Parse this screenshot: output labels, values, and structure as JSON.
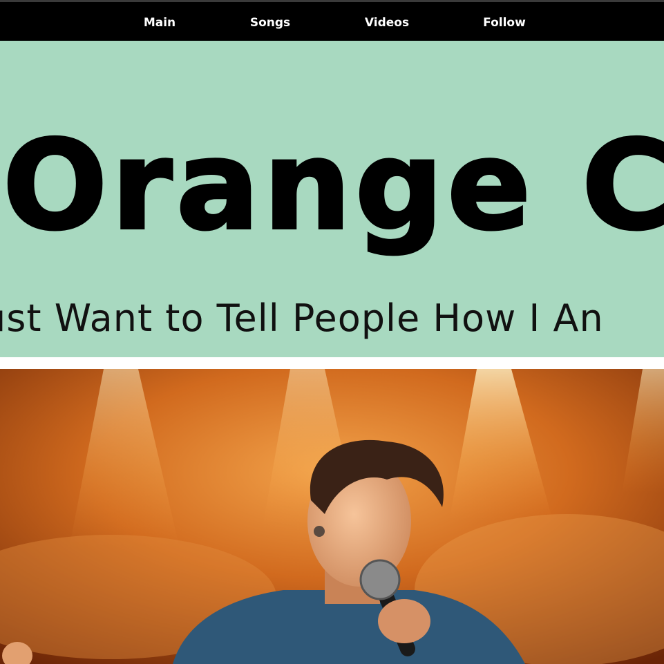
{
  "nav": {
    "items": [
      "Main",
      "Songs",
      "Videos",
      "Follow"
    ]
  },
  "hero": {
    "title": "Orange Cou",
    "subtitle": "ust Want to Tell People How I An"
  },
  "photo": {
    "subject": "singer-with-microphone-icon"
  },
  "colors": {
    "nav_bg": "#000000",
    "hero_bg": "#a8d9c0",
    "text": "#000000"
  }
}
